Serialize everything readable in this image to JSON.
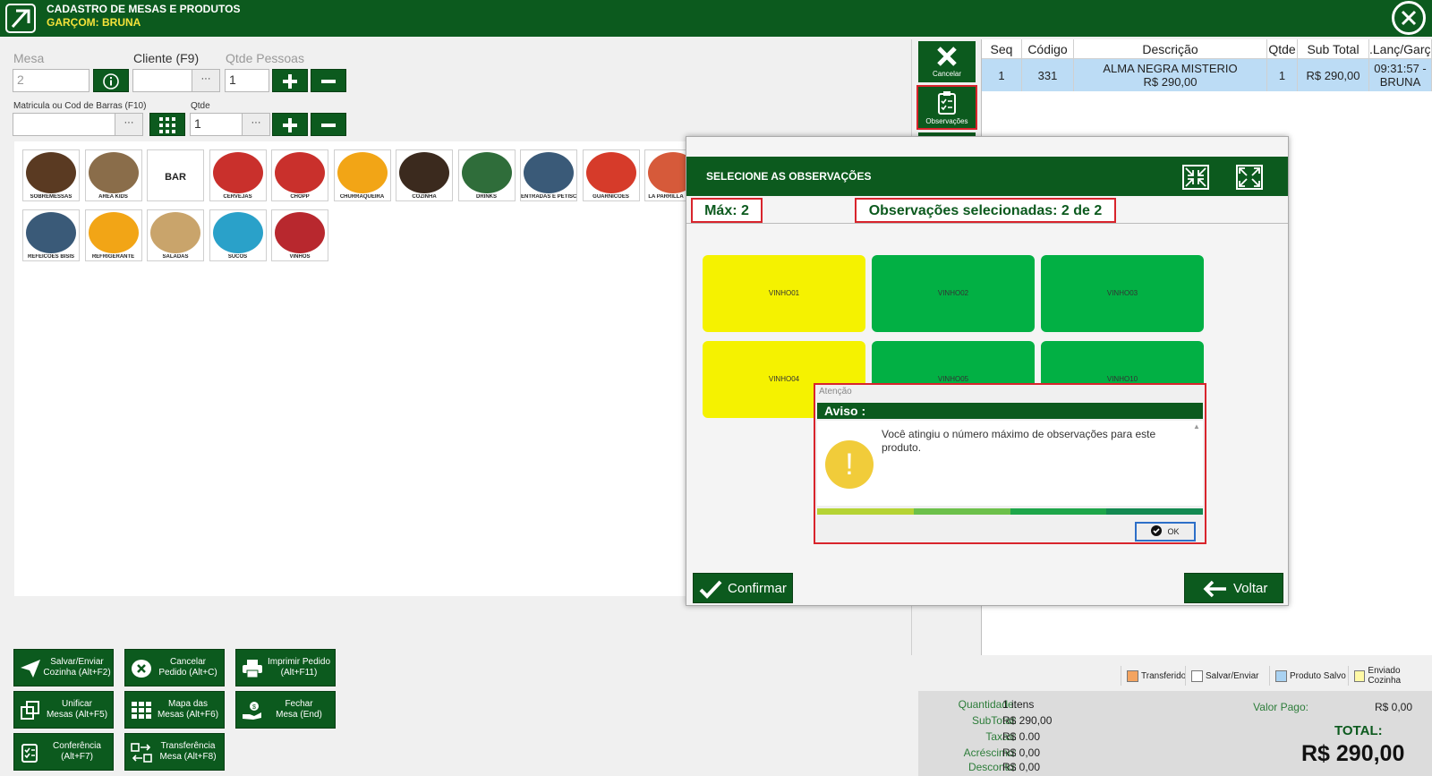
{
  "header": {
    "title": "CADASTRO DE MESAS E PRODUTOS",
    "waiter": "GARÇOM: BRUNA"
  },
  "form": {
    "mesa_label": "Mesa",
    "mesa_value": "2",
    "cliente_label": "Cliente (F9)",
    "cliente_value": "",
    "dots": "···",
    "pessoas_label": "Qtde Pessoas",
    "pessoas_value": "1",
    "matricula_label": "Matricula ou Cod de Barras (F10)",
    "matricula_value": "",
    "qtde_label": "Qtde",
    "qtde_value": "1"
  },
  "categories": [
    {
      "label": "SOBREMESSAS",
      "color": "#5a3a22"
    },
    {
      "label": "AREA KIDS",
      "color": "#8a6d4a"
    },
    {
      "label": "BAR",
      "color": "#ffffff"
    },
    {
      "label": "CERVEJAS",
      "color": "#c9302c"
    },
    {
      "label": "CHOPP",
      "color": "#c9302c"
    },
    {
      "label": "CHURRAQUEIRA",
      "color": "#f2a516"
    },
    {
      "label": "COZINHA",
      "color": "#3b2a1e"
    },
    {
      "label": "DRINKS",
      "color": "#2f6d3a"
    },
    {
      "label": "ENTRADAS E PETISCOS",
      "color": "#3a5a78"
    },
    {
      "label": "GUARNICOES",
      "color": "#d63b2a"
    },
    {
      "label": "LA PARRILLA",
      "color": "#d65a3a"
    },
    {
      "label": "REFEICOES BISIS",
      "color": "#3a5a78"
    },
    {
      "label": "REFRIGERANTE",
      "color": "#f2a516"
    },
    {
      "label": "SALADAS",
      "color": "#c9a46b"
    },
    {
      "label": "SUCOS",
      "color": "#2aa1c9"
    },
    {
      "label": "VINHOS",
      "color": "#b8282e"
    }
  ],
  "actions": [
    {
      "label": "Salvar/Enviar\nCozinha (Alt+F2)"
    },
    {
      "label": "Cancelar\nPedido (Alt+C)"
    },
    {
      "label": "Imprimir Pedido\n(Alt+F11)"
    },
    {
      "label": "Unificar\nMesas (Alt+F5)"
    },
    {
      "label": "Mapa das\nMesas (Alt+F6)"
    },
    {
      "label": "Fechar\nMesa (End)"
    },
    {
      "label": "Conferência\n(Alt+F7)"
    },
    {
      "label": "Transferência\nMesa (Alt+F8)"
    }
  ],
  "side": {
    "cancel": "Cancelar",
    "observations": "Observações"
  },
  "order": {
    "columns": [
      "Seq",
      "Código",
      "Descrição",
      "Qtde",
      "Sub Total",
      ".Lanç/Garçom"
    ],
    "row": {
      "seq": "1",
      "code": "331",
      "desc_line1": "ALMA NEGRA MISTERIO",
      "desc_line2": "R$ 290,00",
      "qty": "1",
      "subtotal": "R$ 290,00",
      "time": "09:31:57 -",
      "waiter": "BRUNA"
    }
  },
  "legend": [
    {
      "label": "Transferido",
      "color": "#f4a460"
    },
    {
      "label": "Salvar/Enviar",
      "color": "#ffffff"
    },
    {
      "label": "Produto Salvo",
      "color": "#a9d2f2"
    },
    {
      "label": "Enviado Cozinha",
      "color": "#fff9a6"
    }
  ],
  "totals": {
    "qty_label": "Quantidade:",
    "qty_value": "1 itens",
    "subtotal_label": "SubTotal:",
    "subtotal_value": "R$ 290,00",
    "taxes_label": "Taxas:",
    "taxes_value": "R$ 0.00",
    "addition_label": "Acréscimo:",
    "addition_value": "R$ 0,00",
    "discount_label": "Desconto:",
    "discount_value": "R$ 0,00",
    "paid_label": "Valor Pago:",
    "paid_value": "R$ 0,00",
    "total_label": "TOTAL:",
    "total_value": "R$ 290,00"
  },
  "obs_dialog": {
    "title": "SELECIONE AS OBSERVAÇÕES",
    "max": "Máx: 2",
    "selected": "Observações selecionadas: 2 de 2",
    "tiles": [
      {
        "label": "VINHO01",
        "state": "selected"
      },
      {
        "label": "VINHO02",
        "state": "available"
      },
      {
        "label": "VINHO03",
        "state": "available"
      },
      {
        "label": "VINHO04",
        "state": "selected"
      },
      {
        "label": "VINHO05",
        "state": "available"
      },
      {
        "label": "VINHO10",
        "state": "available"
      }
    ],
    "confirm": "Confirmar",
    "back": "Voltar"
  },
  "alert": {
    "caption": "Atenção",
    "heading": "Aviso :",
    "message": "Você atingiu o número máximo de observações para este produto.",
    "ok": "OK"
  },
  "colors": {
    "brand_green": "#0c5a1e",
    "tile_selected": "#f5f200",
    "tile_available": "#02b044",
    "highlight": "#d8242c"
  }
}
